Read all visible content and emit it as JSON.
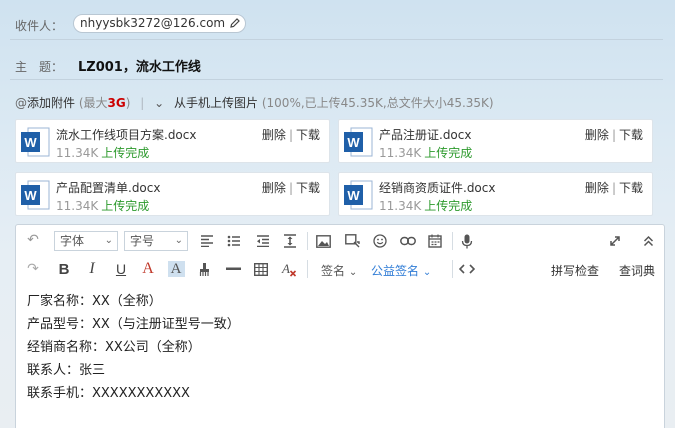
{
  "recipient": {
    "label": "收件人：",
    "email": "nhyysbk3272@126.com"
  },
  "subject": {
    "label": "主　题：",
    "value": "LZ001，流水工作线"
  },
  "attach_bar": {
    "add_label": "添加附件",
    "max_prefix": "(最大",
    "max_value": "3G",
    "max_suffix": ")",
    "phone_upload": "从手机上传图片",
    "summary": "(100%,已上传45.35K,总文件大小45.35K)"
  },
  "attachments": [
    {
      "name": "流水工作线项目方案.docx",
      "size": "11.34K",
      "status": "上传完成",
      "delete": "删除",
      "download": "下载"
    },
    {
      "name": "产品注册证.docx",
      "size": "11.34K",
      "status": "上传完成",
      "delete": "删除",
      "download": "下载"
    },
    {
      "name": "产品配置清单.docx",
      "size": "11.34K",
      "status": "上传完成",
      "delete": "删除",
      "download": "下载"
    },
    {
      "name": "经销商资质证件.docx",
      "size": "11.34K",
      "status": "上传完成",
      "delete": "删除",
      "download": "下载"
    }
  ],
  "toolbar": {
    "font_family": "字体",
    "font_size": "字号",
    "signature": "签名",
    "charity_signature": "公益签名",
    "spell_check": "拼写检查",
    "dictionary": "查词典"
  },
  "body_lines": [
    "厂家名称：XX（全称）",
    "产品型号：XX（与注册证型号一致）",
    "经销商名称：XX公司（全称）",
    "联系人：张三",
    "联系手机：XXXXXXXXXXX"
  ],
  "colors": {
    "accent": "#2f7cd6",
    "success": "#2d9a2d",
    "danger": "#cc0000",
    "word_blue": "#1f5fa8"
  }
}
